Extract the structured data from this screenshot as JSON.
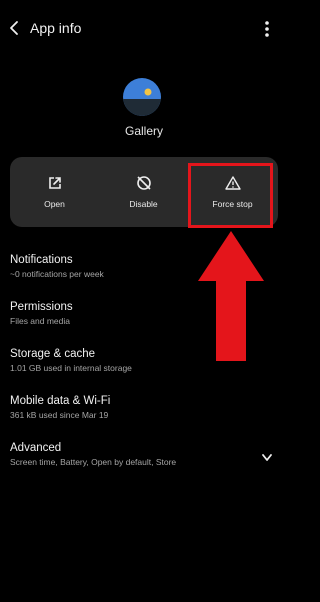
{
  "header": {
    "title": "App info",
    "back_icon": "arrow-back-icon",
    "menu_icon": "more-vert-icon"
  },
  "app": {
    "name": "Gallery",
    "icon": "gallery-app-icon",
    "icon_colors": {
      "sky": "#3d7fd8",
      "ground": "#1f2b36",
      "sun": "#f3c545"
    }
  },
  "actions": [
    {
      "label": "Open",
      "icon": "open-external-icon"
    },
    {
      "label": "Disable",
      "icon": "disable-icon"
    },
    {
      "label": "Force stop",
      "icon": "warning-icon"
    }
  ],
  "annotation": {
    "highlight_color": "#e4151b",
    "arrow_icon": "up-arrow-icon"
  },
  "settings": [
    {
      "title": "Notifications",
      "subtitle": "~0 notifications per week"
    },
    {
      "title": "Permissions",
      "subtitle": "Files and media"
    },
    {
      "title": "Storage & cache",
      "subtitle": "1.01 GB used in internal storage"
    },
    {
      "title": "Mobile data & Wi-Fi",
      "subtitle": "361 kB used since Mar 19"
    },
    {
      "title": "Advanced",
      "subtitle": "Screen time, Battery, Open by default, Store",
      "expand_icon": "chevron-down-icon"
    }
  ]
}
